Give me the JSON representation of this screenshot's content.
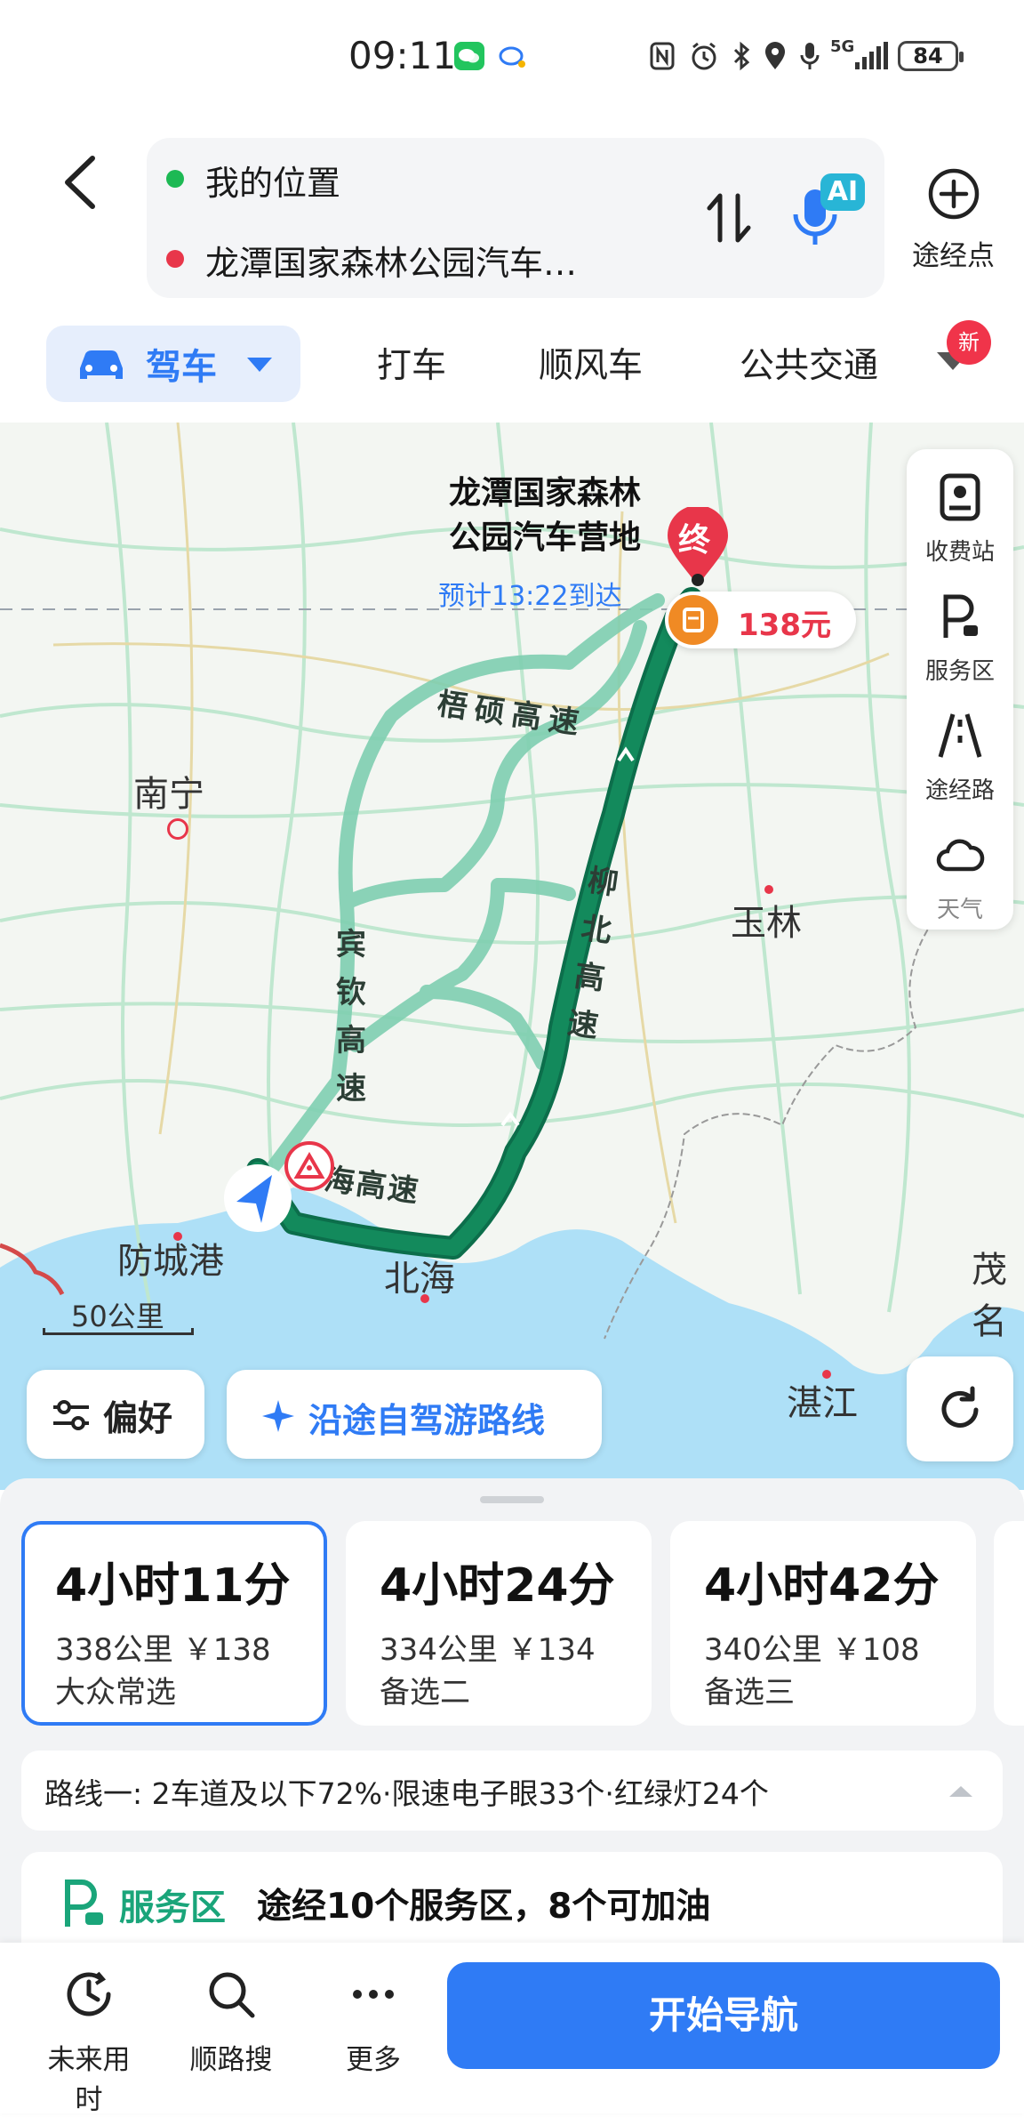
{
  "status_bar": {
    "time": "09:11",
    "battery": "84",
    "network": "5G"
  },
  "header": {
    "origin": "我的位置",
    "destination": "龙潭国家森林公园汽车…",
    "waypoint_label": "途经点",
    "ai_label": "AI"
  },
  "modes": {
    "active": "驾车",
    "tabs": [
      "打车",
      "顺风车",
      "公共交通"
    ],
    "new_badge": "新"
  },
  "map": {
    "destination_name_line1": "龙潭国家森林",
    "destination_name_line2": "公园汽车营地",
    "eta": "预计13:22到达",
    "end_marker": "终",
    "toll_fee": "138元",
    "cities": [
      "南宁",
      "玉林",
      "防城港",
      "北海",
      "湛江",
      "茂名"
    ],
    "roads": {
      "wushuo": "梧硕高速",
      "liubei": "柳北高速",
      "binqin": "宾钦高速",
      "haigao": "海高速"
    },
    "scale": "50公里",
    "preference_button": "偏好",
    "scenic_route_button": "沿途自驾游路线",
    "tools": [
      {
        "icon": "toll-station-icon",
        "label": "收费站"
      },
      {
        "icon": "service-area-icon",
        "label": "服务区"
      },
      {
        "icon": "via-road-icon",
        "label": "途经路"
      },
      {
        "icon": "weather-icon",
        "label": "天气"
      }
    ]
  },
  "routes": [
    {
      "duration": "4小时11分",
      "detail": "338公里 ￥138",
      "tag": "大众常选",
      "selected": true
    },
    {
      "duration": "4小时24分",
      "detail": "334公里 ￥134",
      "tag": "备选二",
      "selected": false
    },
    {
      "duration": "4小时42分",
      "detail": "340公里 ￥108",
      "tag": "备选三",
      "selected": false
    }
  ],
  "route_info": "路线一:  2车道及以下72%·限速电子眼33个·红绿灯24个",
  "service_area": {
    "title": "服务区",
    "text": "途经10个服务区，8个可加油"
  },
  "bottom_bar": {
    "future_time": "未来用时",
    "along_search": "顺路搜",
    "more": "更多",
    "start_nav": "开始导航"
  },
  "colors": {
    "accent": "#2f7bf5",
    "route_main": "#127a55",
    "route_alt": "#7fcfb1",
    "end_marker": "#e8364a",
    "toll_marker": "#f08a24"
  }
}
